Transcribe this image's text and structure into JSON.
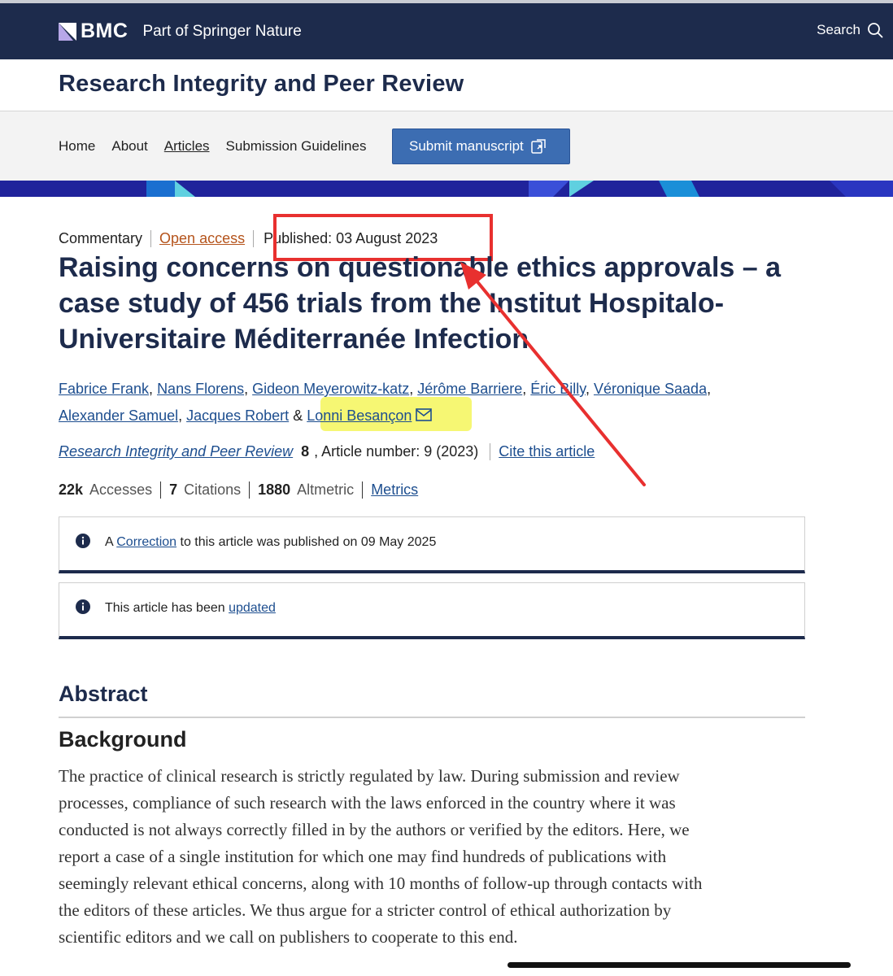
{
  "header": {
    "brand_name": "BMC",
    "brand_sub": "Part of Springer Nature",
    "search_label": "Search"
  },
  "journal": {
    "title": "Research Integrity and Peer Review"
  },
  "nav": {
    "items": [
      {
        "label": "Home",
        "active": false
      },
      {
        "label": "About",
        "active": false
      },
      {
        "label": "Articles",
        "active": true
      },
      {
        "label": "Submission Guidelines",
        "active": false
      }
    ],
    "submit_label": "Submit manuscript"
  },
  "article": {
    "type": "Commentary",
    "open_access": "Open access",
    "published": "Published: 03 August 2023",
    "title": "Raising concerns on questionable ethics approvals – a case study of 456 trials from the Institut Hospitalo-Universitaire Méditerranée Infection",
    "authors": [
      "Fabrice Frank",
      "Nans Florens",
      "Gideon Meyerowitz-katz",
      "Jérôme Barriere",
      "Éric Billy",
      "Véronique Saada",
      "Alexander Samuel",
      "Jacques Robert",
      "Lonni Besançon"
    ],
    "and_sep": "&",
    "citation": {
      "journal": "Research Integrity and Peer Review",
      "volume": "8",
      "rest": ", Article number: 9 (2023)",
      "cite_label": "Cite this article"
    },
    "metrics": {
      "accesses_value": "22k",
      "accesses_label": "Accesses",
      "citations_value": "7",
      "citations_label": "Citations",
      "altmetric_value": "1880",
      "altmetric_label": "Altmetric",
      "metrics_link": "Metrics"
    }
  },
  "notices": [
    {
      "prefix": "A ",
      "link": "Correction",
      "suffix": " to this article was published on 09 May 2025"
    },
    {
      "prefix": "This article has been ",
      "link": "updated",
      "suffix": ""
    }
  ],
  "abstract": {
    "heading": "Abstract",
    "subheading": "Background",
    "lines": [
      "The practice of clinical research is strictly regulated by law. During submission and review",
      "processes, compliance of such research with the laws enforced in the country where it was",
      "conducted is not always correctly filled in by the authors or verified by the editors. Here, we",
      "report a case of a single institution for which one may find hundreds of publications with",
      "seemingly relevant ethical concerns, along with 10 months of follow-up through contacts with",
      "the editors of these articles. We thus argue for a stricter control of ethical authorization by",
      "scientific editors and we call on publishers to cooperate to this end."
    ]
  },
  "colors": {
    "header_bg": "#1d2b4c",
    "link": "#1d4e8f",
    "open_access": "#b5541c",
    "button": "#3c6db2",
    "annotation_red": "#e8302f",
    "annotation_yellow": "#f4f65a"
  },
  "icons": {
    "search": "search-icon",
    "external": "external-window-icon",
    "mail": "mail-icon",
    "info": "info-icon"
  }
}
